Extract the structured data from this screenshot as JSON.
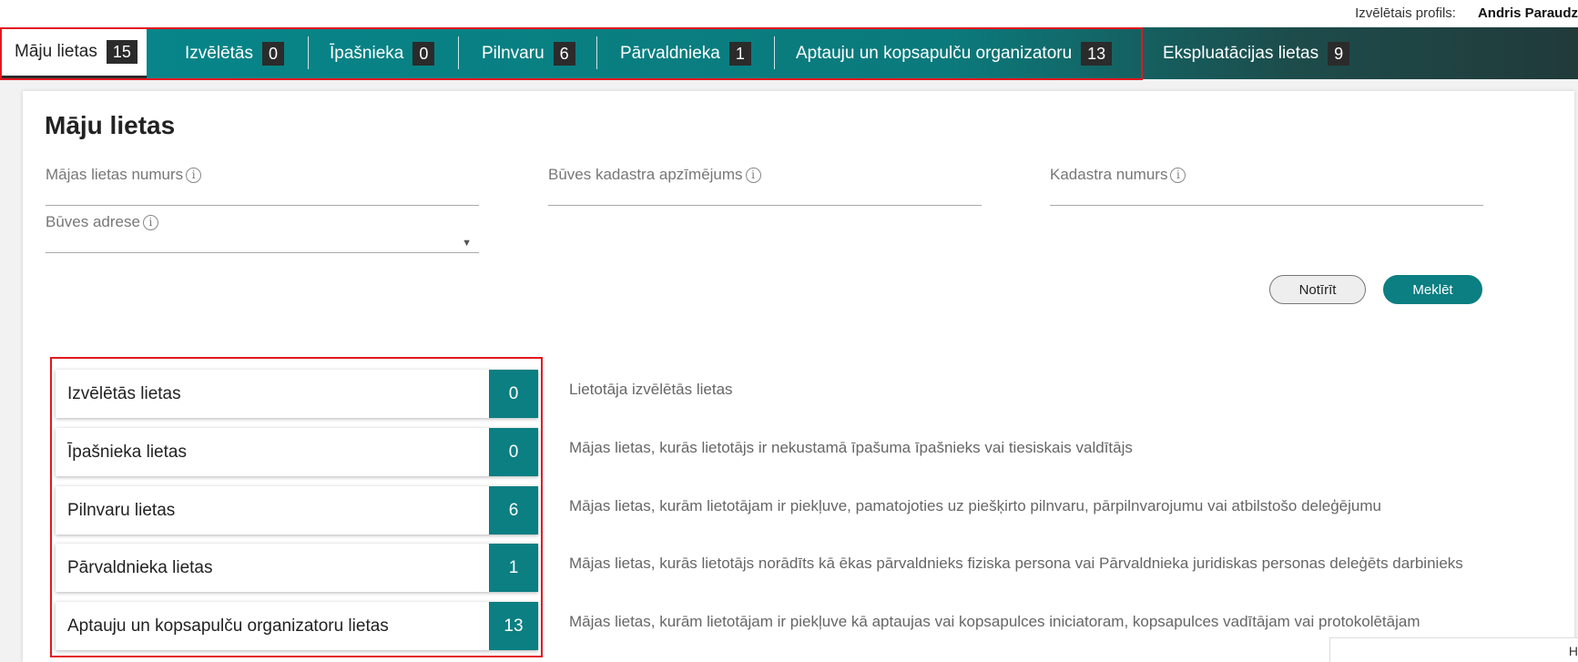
{
  "profile": {
    "label": "Izvēlētais profils:",
    "name": "Andris Paraudz"
  },
  "tabs": [
    {
      "label": "Māju lietas",
      "count": "15"
    },
    {
      "label": "Izvēlētās",
      "count": "0"
    },
    {
      "label": "Īpašnieka",
      "count": "0"
    },
    {
      "label": "Pilnvaru",
      "count": "6"
    },
    {
      "label": "Pārvaldnieka",
      "count": "1"
    },
    {
      "label": "Aptauju un kopsapulču organizatoru",
      "count": "13"
    },
    {
      "label": "Ekspluatācijas lietas",
      "count": "9"
    }
  ],
  "page_title": "Māju lietas",
  "filters": {
    "case_number": {
      "label": "Mājas lietas numurs",
      "value": ""
    },
    "cadastre_designation": {
      "label": "Būves kadastra apzīmējums",
      "value": ""
    },
    "cadastre_number": {
      "label": "Kadastra numurs",
      "value": ""
    },
    "address": {
      "label": "Būves adrese",
      "value": ""
    },
    "info_glyph": "i"
  },
  "buttons": {
    "clear": "Notīrīt",
    "search": "Meklēt"
  },
  "tiles": [
    {
      "label": "Izvēlētās lietas",
      "count": "0",
      "description": "Lietotāja izvēlētās lietas"
    },
    {
      "label": "Īpašnieka lietas",
      "count": "0",
      "description": "Mājas lietas, kurās lietotājs ir nekustamā īpašuma īpašnieks vai tiesiskais valdītājs"
    },
    {
      "label": "Pilnvaru lietas",
      "count": "6",
      "description": "Mājas lietas, kurām lietotājam ir piekļuve, pamatojoties uz piešķirto pilnvaru, pārpilnvarojumu vai atbilstošo deleģējumu"
    },
    {
      "label": "Pārvaldnieka lietas",
      "count": "1",
      "description": "Mājas lietas, kurās lietotājs norādīts kā ēkas pārvaldnieks fiziska persona vai Pārvaldnieka juridiskas personas deleģēts darbinieks"
    },
    {
      "label": "Aptauju un kopsapulču organizatoru lietas",
      "count": "13",
      "description": "Mājas lietas, kurām lietotājam ir piekļuve kā aptaujas vai kopsapulces iniciatoram, kopsapulces vadītājam vai protokolētājam"
    }
  ],
  "corner_text": "H",
  "colors": {
    "accent": "#0b7f82",
    "highlight": "#e2181f",
    "badge": "#2b2b2b"
  }
}
